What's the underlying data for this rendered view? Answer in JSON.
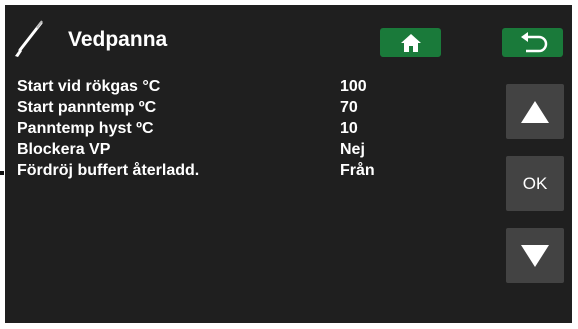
{
  "header": {
    "title": "Vedpanna",
    "icon": "wood-tool-icon",
    "home_icon": "home-icon",
    "back_icon": "back-arrow-icon",
    "accent": "#1a7a3a"
  },
  "settings": [
    {
      "label": "Start vid rökgas °C",
      "value": "100"
    },
    {
      "label": "Start panntemp ºC",
      "value": "70"
    },
    {
      "label": "Panntemp hyst ºC",
      "value": "10"
    },
    {
      "label": "Blockera VP",
      "value": "Nej"
    },
    {
      "label": "Fördröj buffert återladd.",
      "value": "Från"
    }
  ],
  "side": {
    "up_icon": "up-arrow-icon",
    "ok_label": "OK",
    "down_icon": "down-arrow-icon",
    "button_color": "#434343"
  }
}
